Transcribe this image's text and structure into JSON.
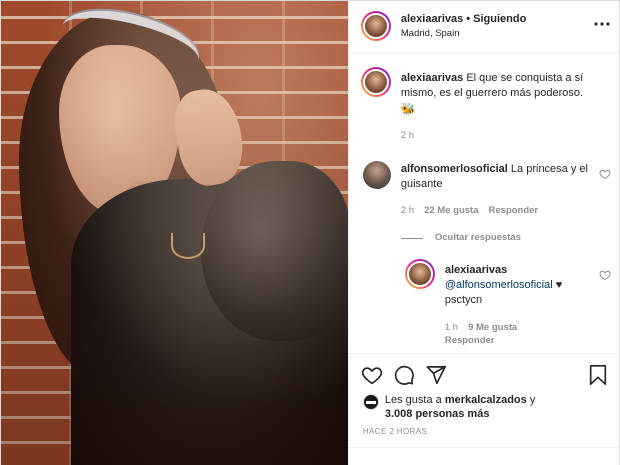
{
  "header": {
    "username": "alexiaarivas",
    "separator": "•",
    "follow_status": "Siguiendo",
    "location": "Madrid, Spain"
  },
  "caption": {
    "username": "alexiaarivas",
    "text": "El que se conquista a sí mismo, es el guerrero más poderoso.",
    "emoji": "🐝",
    "time": "2 h"
  },
  "comment1": {
    "username": "alfonsomerlosoficial",
    "text": "La princesa y el guisante",
    "time": "2 h",
    "likes": "22 Me gusta",
    "reply": "Responder"
  },
  "replies_toggle": "Ocultar respuestas",
  "reply1": {
    "username": "alexiaarivas",
    "mention": "@alfonsomerlosoficial",
    "text_suffix": "♥",
    "second_line": "psctycn",
    "time": "1 h",
    "likes": "9 Me gusta",
    "reply": "Responder"
  },
  "likes_line": {
    "prefix": "Les gusta a",
    "user": "merkalcalzados",
    "conj": "y",
    "count": "3.008 personas más"
  },
  "timestamp": "HACE 2 HORAS",
  "colors": {
    "link": "#00376b",
    "meta": "#8e8e8e",
    "text": "#262626",
    "border": "#efefef"
  },
  "icons": [
    "more-icon",
    "heart-icon",
    "comment-icon",
    "share-icon",
    "bookmark-icon"
  ]
}
